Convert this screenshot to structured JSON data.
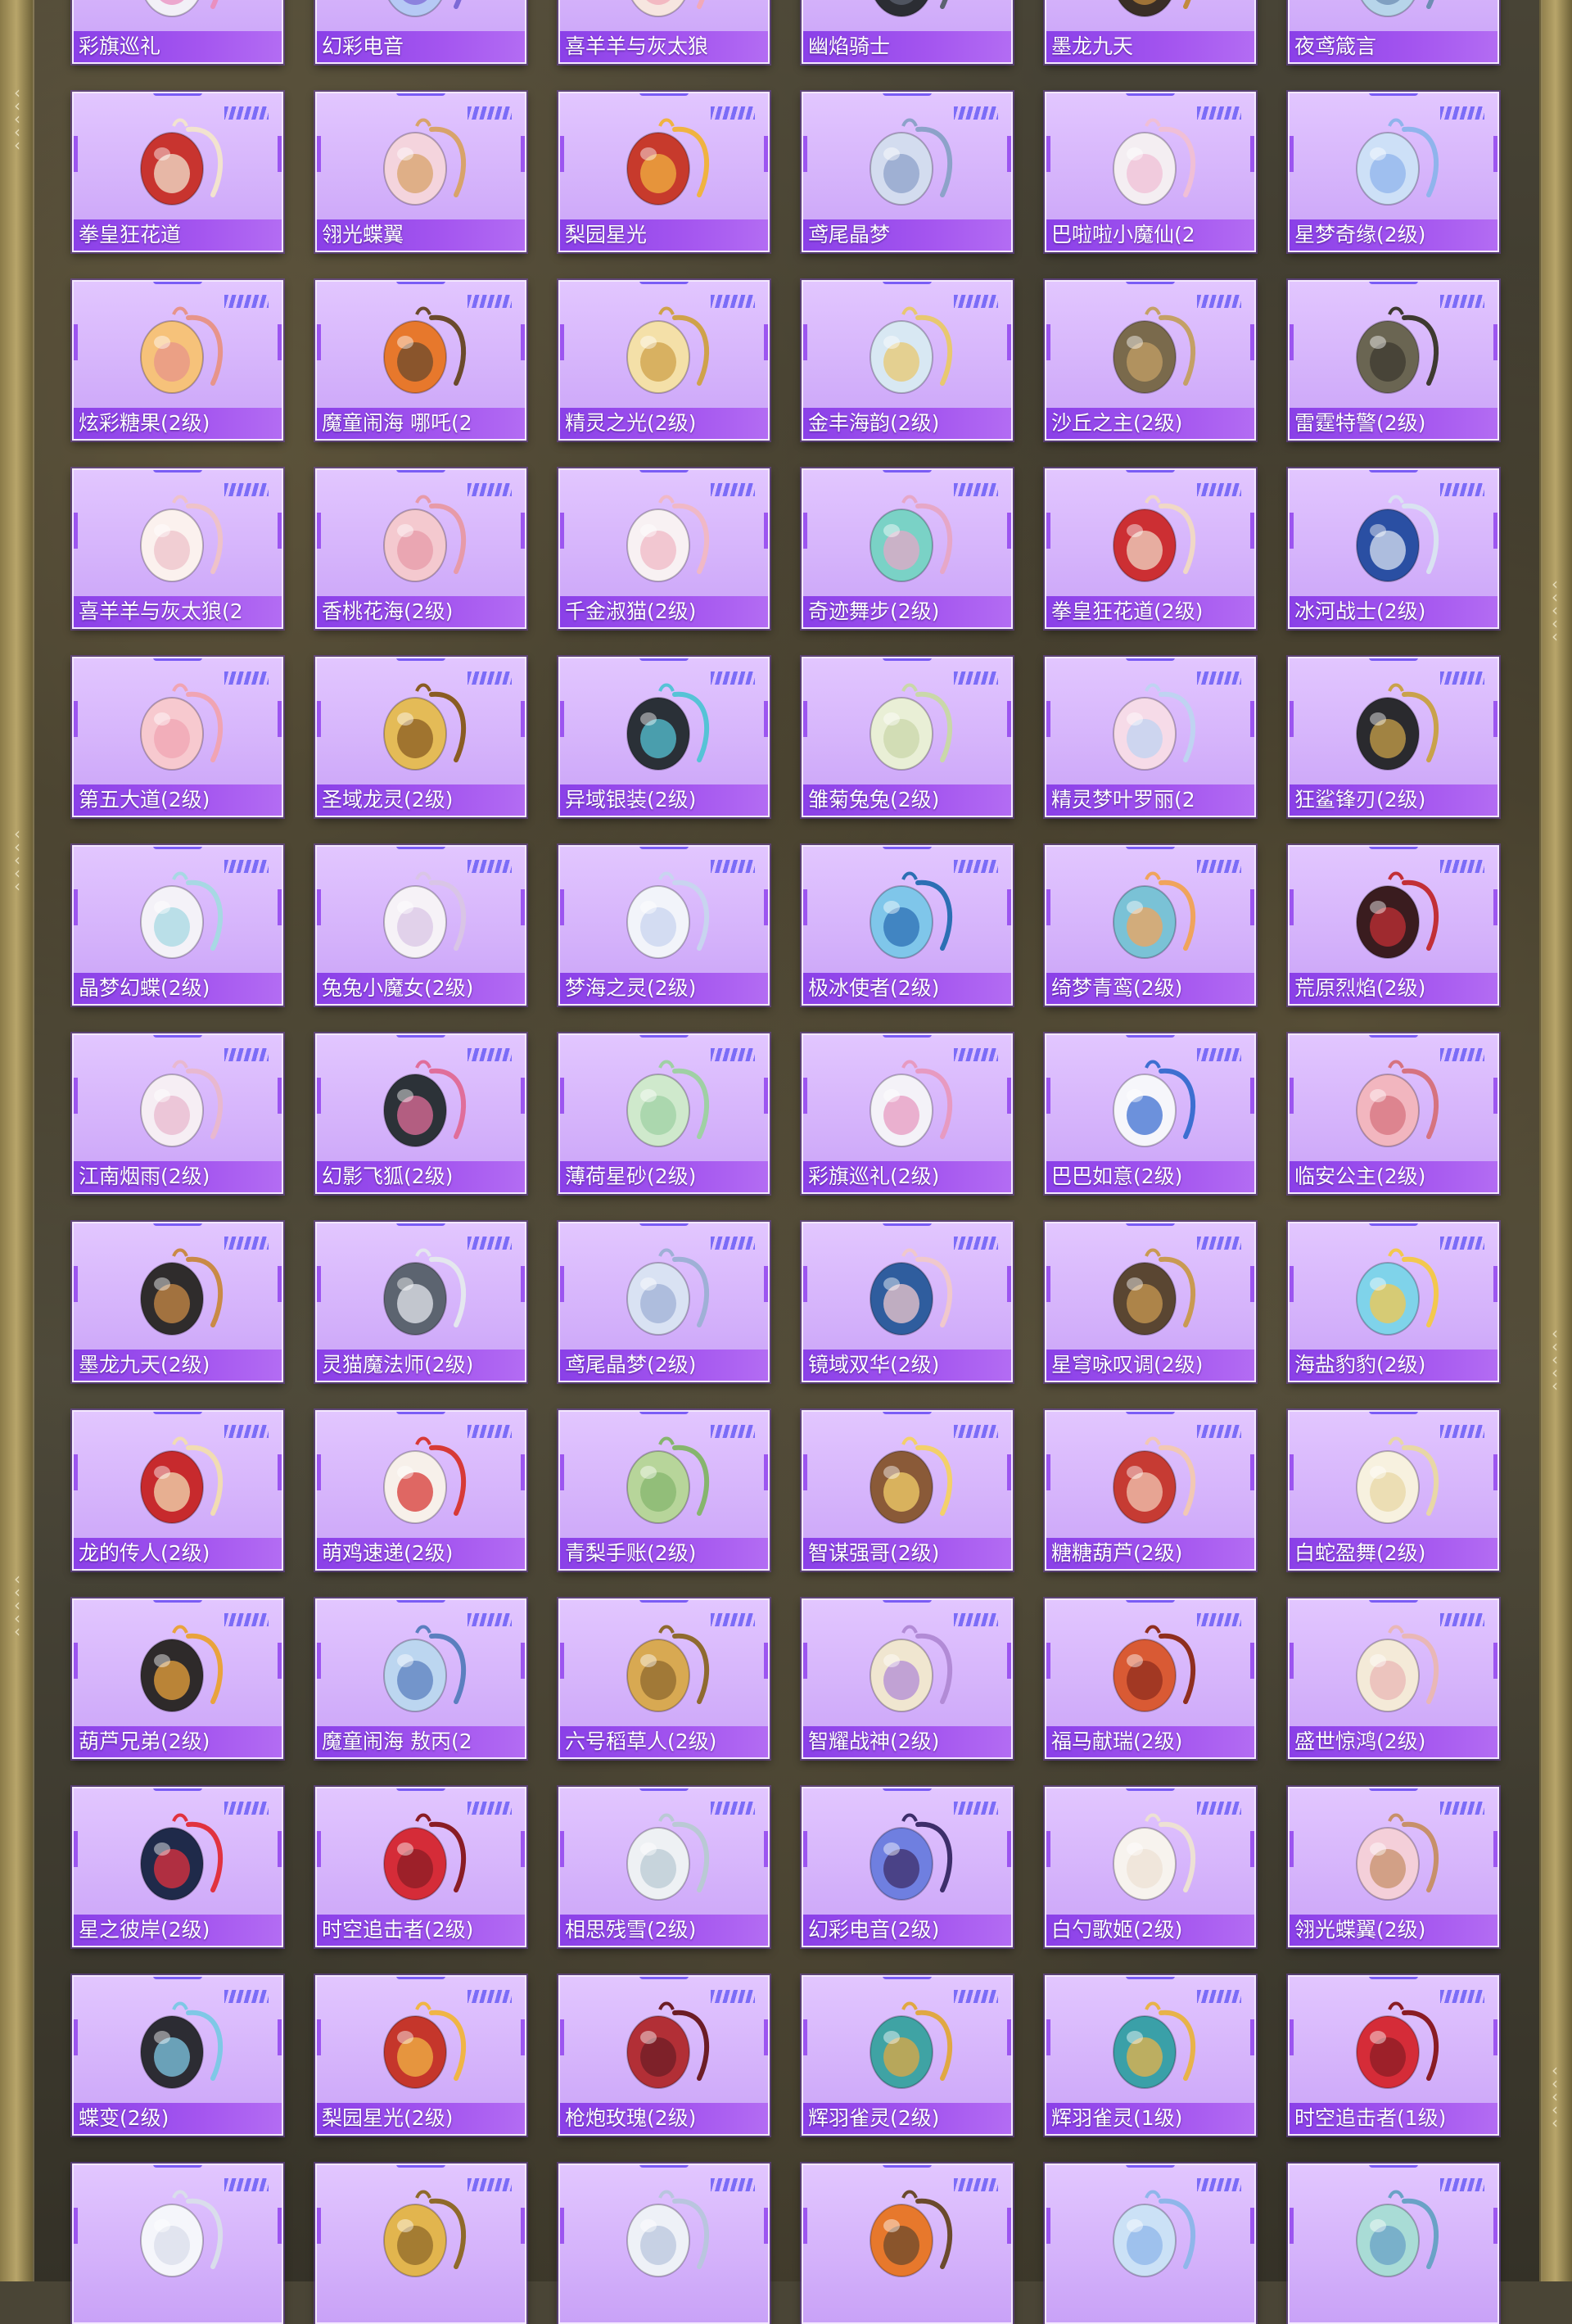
{
  "palette": {
    "card_bg": "#d5b3fb",
    "label_bg": "#9b4ff0",
    "accent": "#7b6cf7",
    "frame_gold": "#b8a56a"
  },
  "items": [
    {
      "name": "彩旗巡礼",
      "icon": "bunny-backpack-icon",
      "c1": "#f2f0f7",
      "c2": "#e98fc0"
    },
    {
      "name": "幻彩电音",
      "icon": "orb-backpack-icon",
      "c1": "#b6c9f5",
      "c2": "#7d69d6"
    },
    {
      "name": "喜羊羊与灰太狼",
      "icon": "sheep-backpack-icon",
      "c1": "#f7e6e0",
      "c2": "#f2a9b8"
    },
    {
      "name": "幽焰骑士",
      "icon": "armor-backpack-icon",
      "c1": "#2b2d33",
      "c2": "#5c6270"
    },
    {
      "name": "墨龙九天",
      "icon": "dragon-backpack-icon",
      "c1": "#3a2e26",
      "c2": "#c28a3e"
    },
    {
      "name": "夜鸢箴言",
      "icon": "pendant-backpack-icon",
      "c1": "#b7d5ea",
      "c2": "#6e8db3"
    },
    {
      "name": "拳皇狂花道",
      "icon": "fan-backpack-icon",
      "c1": "#c8342f",
      "c2": "#f2e3cf"
    },
    {
      "name": "翎光蝶翼",
      "icon": "heart-backpack-icon",
      "c1": "#f4d4dd",
      "c2": "#d8a36a"
    },
    {
      "name": "梨园星光",
      "icon": "opera-backpack-icon",
      "c1": "#c73a2c",
      "c2": "#f0b340"
    },
    {
      "name": "鸢尾晶梦",
      "icon": "crystal-backpack-icon",
      "c1": "#d3dcef",
      "c2": "#8da2c9"
    },
    {
      "name": "巴啦啦小魔仙(2",
      "icon": "castle-backpack-icon",
      "c1": "#f4eef2",
      "c2": "#f0bfd6"
    },
    {
      "name": "星梦奇缘(2级)",
      "icon": "swan-backpack-icon",
      "c1": "#cde0f7",
      "c2": "#8fb4ec"
    },
    {
      "name": "炫彩糖果(2级)",
      "icon": "candy-backpack-icon",
      "c1": "#f6c27a",
      "c2": "#e7948a"
    },
    {
      "name": "魔童闹海 哪吒(2",
      "icon": "ring-backpack-icon",
      "c1": "#e7782c",
      "c2": "#6b4a2c"
    },
    {
      "name": "精灵之光(2级)",
      "icon": "gold-backpack-icon",
      "c1": "#f4e0a8",
      "c2": "#cfa24a"
    },
    {
      "name": "金丰海韵(2级)",
      "icon": "tiger-backpack-icon",
      "c1": "#d8e8f3",
      "c2": "#e8c870"
    },
    {
      "name": "沙丘之主(2级)",
      "icon": "scroll-backpack-icon",
      "c1": "#7a6a4c",
      "c2": "#c4a066"
    },
    {
      "name": "雷霆特警(2级)",
      "icon": "tactical-backpack-icon",
      "c1": "#6a6552",
      "c2": "#3e3a30"
    },
    {
      "name": "喜羊羊与灰太狼(2",
      "icon": "sheep-backpack-icon",
      "c1": "#fbf1ee",
      "c2": "#eec2c9"
    },
    {
      "name": "香桃花海(2级)",
      "icon": "peach-backpack-icon",
      "c1": "#f4c9cf",
      "c2": "#e79aa8"
    },
    {
      "name": "千金淑猫(2级)",
      "icon": "bow-backpack-icon",
      "c1": "#f8f1f3",
      "c2": "#f0b8c6"
    },
    {
      "name": "奇迹舞步(2级)",
      "icon": "dancer-backpack-icon",
      "c1": "#7ad2c6",
      "c2": "#e6a7c7"
    },
    {
      "name": "拳皇狂花道(2级)",
      "icon": "flower-backpack-icon",
      "c1": "#cc2f33",
      "c2": "#f0d8c6"
    },
    {
      "name": "冰河战士(2级)",
      "icon": "shield-backpack-icon",
      "c1": "#2a4fa3",
      "c2": "#d9e2f1"
    },
    {
      "name": "第五大道(2级)",
      "icon": "purse-backpack-icon",
      "c1": "#f7c9cf",
      "c2": "#f0a4b3"
    },
    {
      "name": "圣域龙灵(2级)",
      "icon": "hourglass-backpack-icon",
      "c1": "#e4bb57",
      "c2": "#8a5c22"
    },
    {
      "name": "异域银装(2级)",
      "icon": "tech-backpack-icon",
      "c1": "#2a3037",
      "c2": "#56c3d6"
    },
    {
      "name": "雏菊兔兔(2级)",
      "icon": "daisy-backpack-icon",
      "c1": "#e9efd6",
      "c2": "#c9d7a9"
    },
    {
      "name": "精灵梦叶罗丽(2",
      "icon": "heart-backpack-icon",
      "c1": "#f6dbe8",
      "c2": "#bfd3f1"
    },
    {
      "name": "狂鲨锋刃(2级)",
      "icon": "shark-backpack-icon",
      "c1": "#2a2a2e",
      "c2": "#c9a24a"
    },
    {
      "name": "晶梦幻蝶(2级)",
      "icon": "butterfly-backpack-icon",
      "c1": "#f4f2f8",
      "c2": "#a7d8e3"
    },
    {
      "name": "兔兔小魔女(2级)",
      "icon": "witch-backpack-icon",
      "c1": "#f6f2f7",
      "c2": "#d9c5e6"
    },
    {
      "name": "梦海之灵(2级)",
      "icon": "shell-backpack-icon",
      "c1": "#f2f4fa",
      "c2": "#c8d4ef"
    },
    {
      "name": "极冰使者(2级)",
      "icon": "ice-backpack-icon",
      "c1": "#7fc6ea",
      "c2": "#2c6fb4"
    },
    {
      "name": "绮梦青鸾(2级)",
      "icon": "bird-backpack-icon",
      "c1": "#7ac2d6",
      "c2": "#f0a45c"
    },
    {
      "name": "荒原烈焰(2级)",
      "icon": "flame-backpack-icon",
      "c1": "#3a1c1f",
      "c2": "#c22f36"
    },
    {
      "name": "江南烟雨(2级)",
      "icon": "lace-backpack-icon",
      "c1": "#f6eef4",
      "c2": "#e8b8cf"
    },
    {
      "name": "幻影飞狐(2级)",
      "icon": "cyber-backpack-icon",
      "c1": "#2c3238",
      "c2": "#e06e9a"
    },
    {
      "name": "薄荷星砂(2级)",
      "icon": "mint-backpack-icon",
      "c1": "#cfe9cc",
      "c2": "#9fd0a4"
    },
    {
      "name": "彩旗巡礼(2级)",
      "icon": "bunny-backpack-icon",
      "c1": "#f4f2f8",
      "c2": "#e79ac1"
    },
    {
      "name": "巴巴如意(2级)",
      "icon": "ghost-backpack-icon",
      "c1": "#f6f6fb",
      "c2": "#3d6fd1"
    },
    {
      "name": "临安公主(2级)",
      "icon": "blossom-backpack-icon",
      "c1": "#f2b6bf",
      "c2": "#d6737f"
    },
    {
      "name": "墨龙九天(2级)",
      "icon": "dragon-backpack-icon",
      "c1": "#2f2c2c",
      "c2": "#c98a46"
    },
    {
      "name": "灵猫魔法师(2级)",
      "icon": "cat-backpack-icon",
      "c1": "#5c6470",
      "c2": "#e4e7ee"
    },
    {
      "name": "鸢尾晶梦(2级)",
      "icon": "crystal-backpack-icon",
      "c1": "#d9e2f3",
      "c2": "#9fb0d6"
    },
    {
      "name": "镜域双华(2级)",
      "icon": "heart-backpack-icon",
      "c1": "#2f5d9e",
      "c2": "#f0c8cc"
    },
    {
      "name": "星穹咏叹调(2级)",
      "icon": "lantern-backpack-icon",
      "c1": "#5a4632",
      "c2": "#c99a52"
    },
    {
      "name": "海盐豹豹(2级)",
      "icon": "seal-backpack-icon",
      "c1": "#7fd3ea",
      "c2": "#f3c84d"
    },
    {
      "name": "龙的传人(2级)",
      "icon": "school-backpack-icon",
      "c1": "#c72a2d",
      "c2": "#f1dcb3"
    },
    {
      "name": "萌鸡速递(2级)",
      "icon": "chick-backpack-icon",
      "c1": "#f7f0ea",
      "c2": "#d73a36"
    },
    {
      "name": "青梨手账(2级)",
      "icon": "pear-backpack-icon",
      "c1": "#b7d59a",
      "c2": "#86b56d"
    },
    {
      "name": "智谋强哥(2级)",
      "icon": "bear-backpack-icon",
      "c1": "#8a5a38",
      "c2": "#f3d06a"
    },
    {
      "name": "糖糖葫芦(2级)",
      "icon": "gourd-backpack-icon",
      "c1": "#c63b33",
      "c2": "#f2c8b4"
    },
    {
      "name": "白蛇盈舞(2级)",
      "icon": "snake-backpack-icon",
      "c1": "#f7f1df",
      "c2": "#e8d7a6"
    },
    {
      "name": "葫芦兄弟(2级)",
      "icon": "gourd-backpack-icon",
      "c1": "#2e2a2a",
      "c2": "#e9a33c"
    },
    {
      "name": "魔童闹海 敖丙(2",
      "icon": "ring-backpack-icon",
      "c1": "#bcd6f0",
      "c2": "#5b7fbf"
    },
    {
      "name": "六号稻草人(2级)",
      "icon": "scarecrow-backpack-icon",
      "c1": "#d8a952",
      "c2": "#8f6a2f"
    },
    {
      "name": "智耀战神(2级)",
      "icon": "armor-backpack-icon",
      "c1": "#f0e6d0",
      "c2": "#b28bd6"
    },
    {
      "name": "福马献瑞(2级)",
      "icon": "horse-backpack-icon",
      "c1": "#d95a34",
      "c2": "#8f2e1e"
    },
    {
      "name": "盛世惊鸿(2级)",
      "icon": "fan-backpack-icon",
      "c1": "#f4ead8",
      "c2": "#e9b7b6"
    },
    {
      "name": "星之彼岸(2级)",
      "icon": "astronaut-backpack-icon",
      "c1": "#1f2a4a",
      "c2": "#e1323f"
    },
    {
      "name": "时空追击者(2级)",
      "icon": "sport-backpack-icon",
      "c1": "#d52c38",
      "c2": "#8a1c24"
    },
    {
      "name": "相思残雪(2级)",
      "icon": "snow-backpack-icon",
      "c1": "#eef1f4",
      "c2": "#b9c9d4"
    },
    {
      "name": "幻彩电音(2级)",
      "icon": "orb-backpack-icon",
      "c1": "#6f7fe0",
      "c2": "#3d2e6a"
    },
    {
      "name": "白勺歌姬(2级)",
      "icon": "bunny-backpack-icon",
      "c1": "#f7f3ee",
      "c2": "#ede1d4"
    },
    {
      "name": "翎光蝶翼(2级)",
      "icon": "heart-backpack-icon",
      "c1": "#f4cfd9",
      "c2": "#c7906a"
    },
    {
      "name": "蝶变(2级)",
      "icon": "butterfly-backpack-icon",
      "c1": "#2c2c33",
      "c2": "#7fc8e6"
    },
    {
      "name": "梨园星光(2级)",
      "icon": "opera-backpack-icon",
      "c1": "#c5362b",
      "c2": "#f0b545"
    },
    {
      "name": "枪炮玫瑰(2级)",
      "icon": "rose-backpack-icon",
      "c1": "#b22f36",
      "c2": "#6c1d25"
    },
    {
      "name": "辉羽雀灵(2级)",
      "icon": "feather-backpack-icon",
      "c1": "#3fa3a4",
      "c2": "#e0a843"
    },
    {
      "name": "辉羽雀灵(1级)",
      "icon": "feather-backpack-icon",
      "c1": "#3aa0a8",
      "c2": "#e8b349"
    },
    {
      "name": "时空追击者(1级)",
      "icon": "sport-backpack-icon",
      "c1": "#d52c38",
      "c2": "#8a1c24"
    },
    {
      "name": "",
      "icon": "bunny-backpack-icon",
      "c1": "#f5f6fb",
      "c2": "#d9ddeb"
    },
    {
      "name": "",
      "icon": "gold-backpack-icon",
      "c1": "#e2b54e",
      "c2": "#8f6a2a"
    },
    {
      "name": "",
      "icon": "bunny-backpack-icon",
      "c1": "#eef1f7",
      "c2": "#b9c5de"
    },
    {
      "name": "",
      "icon": "ring-backpack-icon",
      "c1": "#e7782c",
      "c2": "#6b4a2c"
    },
    {
      "name": "",
      "icon": "swan-backpack-icon",
      "c1": "#cbe1f6",
      "c2": "#8fb6ea"
    },
    {
      "name": "",
      "icon": "pendant-backpack-icon",
      "c1": "#a9dcd6",
      "c2": "#6aa2c6"
    }
  ]
}
